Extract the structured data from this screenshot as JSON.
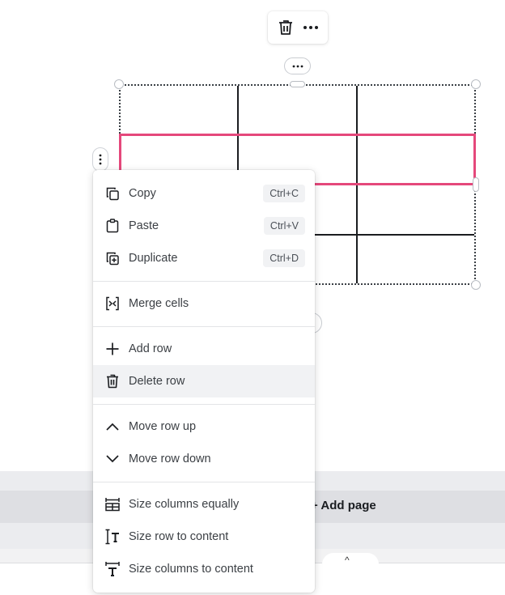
{
  "toolbar": {
    "delete_icon": "trash-icon",
    "more_icon": "more-horizontal-icon"
  },
  "table_more_icon": "more-horizontal-icon",
  "row_handle_icon": "more-vertical-icon",
  "bottom_bar": {
    "add_page_label": "+ Add page",
    "expand_icon": "caret-up-icon"
  },
  "colors": {
    "selection_accent": "#e5487b",
    "menu_hover": "#f1f2f4"
  },
  "context_menu": {
    "groups": [
      {
        "items": [
          {
            "label": "Copy",
            "icon": "copy-icon",
            "shortcut": "Ctrl+C"
          },
          {
            "label": "Paste",
            "icon": "paste-icon",
            "shortcut": "Ctrl+V"
          },
          {
            "label": "Duplicate",
            "icon": "duplicate-icon",
            "shortcut": "Ctrl+D"
          }
        ]
      },
      {
        "items": [
          {
            "label": "Merge cells",
            "icon": "merge-cells-icon"
          }
        ]
      },
      {
        "items": [
          {
            "label": "Add row",
            "icon": "plus-icon"
          },
          {
            "label": "Delete row",
            "icon": "trash-icon",
            "hovered": true
          }
        ]
      },
      {
        "items": [
          {
            "label": "Move row up",
            "icon": "chevron-up-icon"
          },
          {
            "label": "Move row down",
            "icon": "chevron-down-icon"
          }
        ]
      },
      {
        "items": [
          {
            "label": "Size columns equally",
            "icon": "size-columns-equally-icon"
          },
          {
            "label": "Size row to content",
            "icon": "size-row-to-content-icon"
          },
          {
            "label": "Size columns to content",
            "icon": "size-columns-to-content-icon"
          }
        ]
      }
    ]
  }
}
